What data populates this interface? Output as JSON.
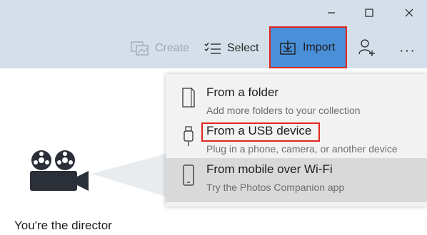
{
  "window": {
    "minimize_icon": "minimize-icon",
    "maximize_icon": "maximize-icon",
    "close_icon": "close-icon"
  },
  "toolbar": {
    "create_label": "Create",
    "select_label": "Select",
    "import_label": "Import",
    "people_icon": "add-person-icon",
    "more_label": "···"
  },
  "main": {
    "director_text": "You're the director"
  },
  "import_menu": {
    "items": [
      {
        "title": "From a folder",
        "subtitle": "Add more folders to your collection",
        "icon": "folder-icon"
      },
      {
        "title": "From a USB device",
        "subtitle": "Plug in a phone, camera, or another device",
        "icon": "usb-icon"
      },
      {
        "title": "From mobile over Wi-Fi",
        "subtitle": "Try the Photos Companion app",
        "icon": "phone-icon"
      }
    ]
  },
  "colors": {
    "topbar": "#d4dfe9",
    "import_bg": "#4a90d9",
    "highlight_border": "#e0271f",
    "menu_bg": "#f2f2f2",
    "menu_hover": "#d9d9d9"
  }
}
